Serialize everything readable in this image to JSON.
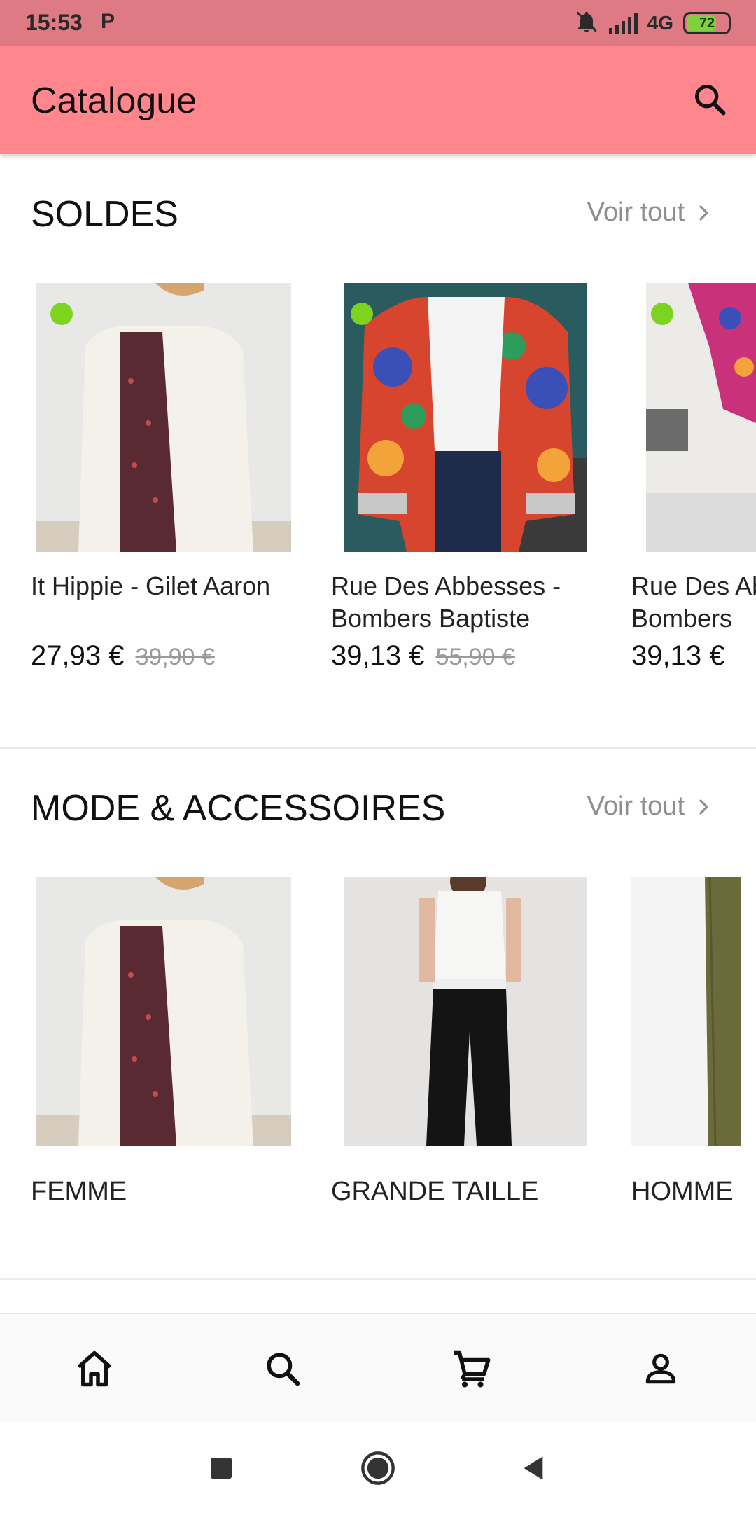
{
  "status_bar": {
    "time": "15:53",
    "carrier_icon": "P",
    "network": "4G",
    "battery": "72"
  },
  "app_bar": {
    "title": "Catalogue",
    "search_icon": "search-icon"
  },
  "sales": {
    "title": "SOLDES",
    "see_all": "Voir tout",
    "products": [
      {
        "name": "It Hippie - Gilet Aaron",
        "price": "27,93 €",
        "old_price": "39,90 €"
      },
      {
        "name": "Rue Des Abbesses - Bombers Baptiste",
        "price": "39,13 €",
        "old_price": "55,90 €"
      },
      {
        "name": "Rue Des Abbesses - Bombers",
        "price": "39,13 €",
        "old_price": ""
      }
    ]
  },
  "fashion": {
    "title": "MODE & ACCESSOIRES",
    "see_all": "Voir tout",
    "categories": [
      {
        "name": "FEMME"
      },
      {
        "name": "GRANDE TAILLE"
      },
      {
        "name": "HOMME"
      }
    ]
  },
  "bottom_nav": {
    "items": [
      "home-icon",
      "search-icon",
      "cart-icon",
      "account-icon"
    ]
  },
  "colors": {
    "app_bar": "#ff868d",
    "status_bar": "#dd7a83",
    "sale_dot": "#7ed321"
  }
}
